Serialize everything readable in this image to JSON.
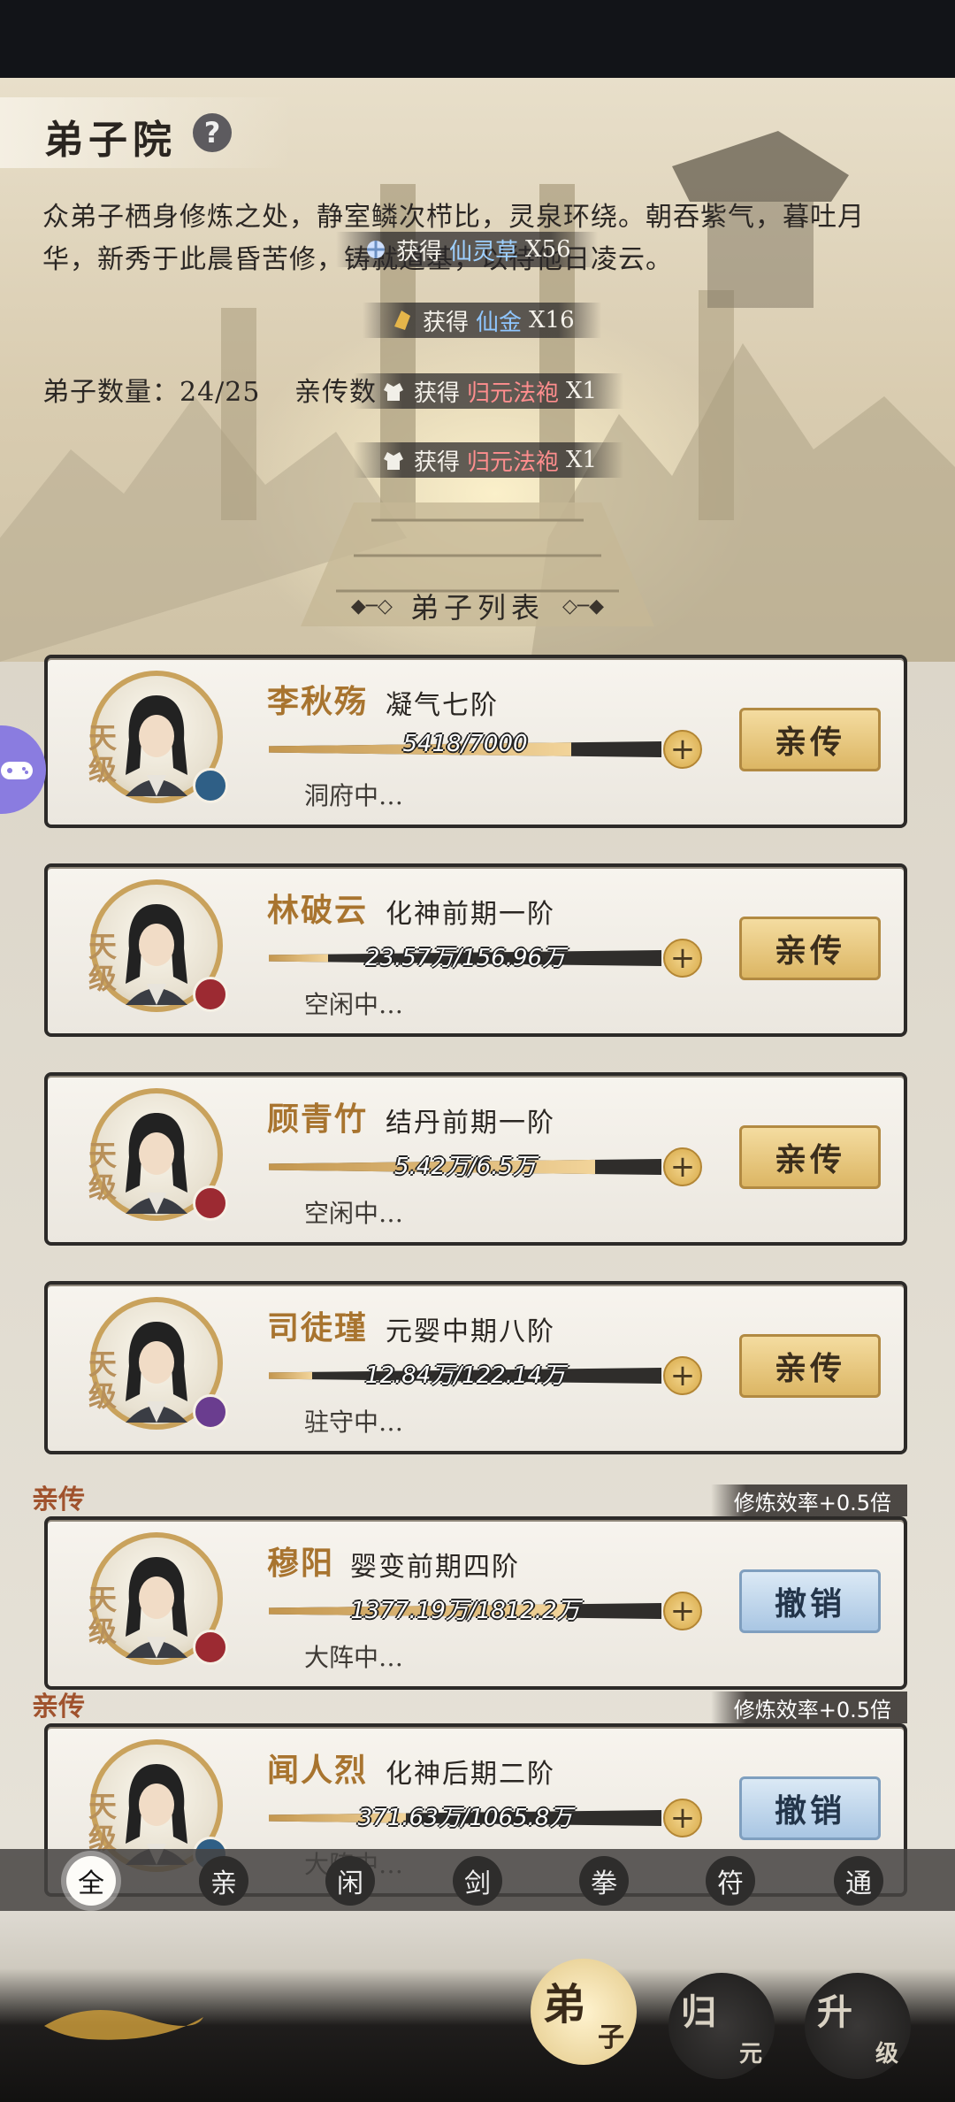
{
  "header": {
    "title": "弟子院",
    "help_icon": "?"
  },
  "description": "众弟子栖身修炼之处，静室鳞次栉比，灵泉环绕。朝吞紫气，暮吐月华，新秀于此晨昏苦修，铸就道基，以待他日凌云。",
  "stats": {
    "disciple_count": "弟子数量：24/25",
    "qinchuan_label": "亲传数"
  },
  "toasts": [
    {
      "prefix": "获得",
      "item": "仙灵草",
      "qty": "X56",
      "icon": "herb-icon"
    },
    {
      "prefix": "获得",
      "item": "仙金",
      "qty": "X16",
      "icon": "gold-icon"
    },
    {
      "prefix": "获得",
      "item": "归元法袍",
      "qty": "X1",
      "icon": "robe-icon"
    },
    {
      "prefix": "获得",
      "item": "归元法袍",
      "qty": "X1",
      "icon": "robe-icon"
    }
  ],
  "list_title": "弟子列表",
  "disciples": [
    {
      "name": "李秋殇",
      "realm": "凝气七阶",
      "progress_text": "5418/7000",
      "progress": 0.77,
      "status": "洞府中…",
      "grade": "天级",
      "button": "亲传",
      "button_type": "gold",
      "element_color": "#2f5f86",
      "qinchuan": false
    },
    {
      "name": "林破云",
      "realm": "化神前期一阶",
      "progress_text": "23.57万/156.96万",
      "progress": 0.15,
      "status": "空闲中…",
      "grade": "天级",
      "button": "亲传",
      "button_type": "gold",
      "element_color": "#9c2a32",
      "qinchuan": false
    },
    {
      "name": "顾青竹",
      "realm": "结丹前期一阶",
      "progress_text": "5.42万/6.5万",
      "progress": 0.83,
      "status": "空闲中…",
      "grade": "天级",
      "button": "亲传",
      "button_type": "gold",
      "element_color": "#9c2a32",
      "qinchuan": false
    },
    {
      "name": "司徒瑾",
      "realm": "元婴中期八阶",
      "progress_text": "12.84万/122.14万",
      "progress": 0.11,
      "status": "驻守中…",
      "grade": "天级",
      "button": "亲传",
      "button_type": "gold",
      "element_color": "#6a3d8f",
      "qinchuan": false
    },
    {
      "name": "穆阳",
      "realm": "婴变前期四阶",
      "progress_text": "1377.19万/1812.2万",
      "progress": 0.76,
      "status": "大阵中…",
      "grade": "天级",
      "button": "撤销",
      "button_type": "blue",
      "element_color": "#9c2a32",
      "qinchuan": true,
      "qinchuan_tag": "亲传",
      "efficiency": "修炼效率+0.5倍"
    },
    {
      "name": "闻人烈",
      "realm": "化神后期二阶",
      "progress_text": "371.63万/1065.8万",
      "progress": 0.35,
      "status": "大阵中…",
      "grade": "天级",
      "button": "撤销",
      "button_type": "blue",
      "element_color": "#2f5f86",
      "qinchuan": true,
      "qinchuan_tag": "亲传",
      "efficiency": "修炼效率+0.5倍"
    }
  ],
  "filters": [
    "全",
    "亲",
    "闲",
    "剑",
    "拳",
    "符",
    "通"
  ],
  "filter_active": 0,
  "nav": {
    "disciple": {
      "big": "弟",
      "small": "子"
    },
    "guiyuan": {
      "big": "归",
      "small": "元"
    },
    "upgrade": {
      "big": "升",
      "small": "级"
    }
  }
}
